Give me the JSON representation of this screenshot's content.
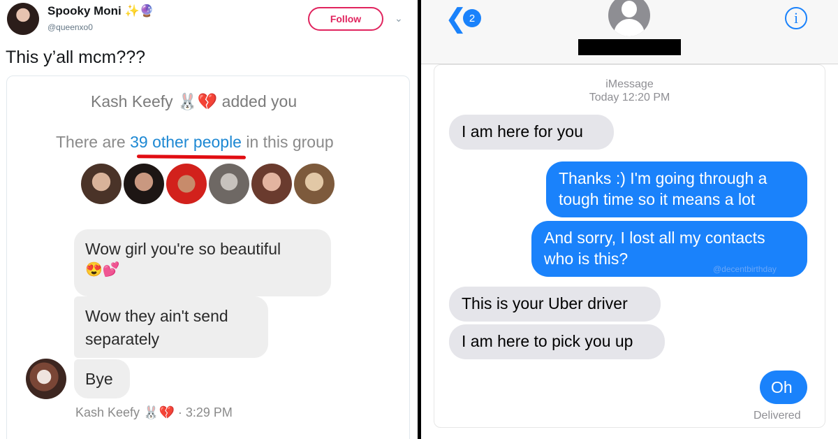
{
  "tweet": {
    "display_name": "Spooky Moni ✨🔮",
    "handle": "@queenxo0",
    "follow_label": "Follow",
    "text": "This y’all mcm???"
  },
  "group": {
    "added_line": "Kash Keefy 🐰💔 added you",
    "prefix": "There are",
    "link": "39 other people",
    "suffix": "in this group",
    "underline_color": "#e10d12",
    "link_color": "#1d88d3"
  },
  "messages_left": {
    "msg1": "Wow girl you're so beautiful",
    "msg1_emoji": "😍💕",
    "msg2": "Wow they ain't send separately",
    "msg3": "Bye",
    "sender_line": "Kash Keefy 🐰💔 · 3:29 PM"
  },
  "imessage": {
    "back_count": "2",
    "info_glyph": "i",
    "service": "iMessage",
    "timestamp": "Today 12:20 PM",
    "bubbles": [
      {
        "side": "in",
        "text": "I am here for you"
      },
      {
        "side": "out",
        "text": "Thanks :) I'm going through a tough time so it means a lot"
      },
      {
        "side": "out",
        "text": "And sorry, I lost all my contacts who is this?"
      },
      {
        "side": "in",
        "text": "This is your Uber driver"
      },
      {
        "side": "in",
        "text": "I am here to pick you up"
      },
      {
        "side": "out",
        "text": "Oh"
      }
    ],
    "watermark": "@decentbirthday",
    "status": "Delivered",
    "accent": "#1a82fb",
    "incoming_color": "#e5e5ea"
  }
}
